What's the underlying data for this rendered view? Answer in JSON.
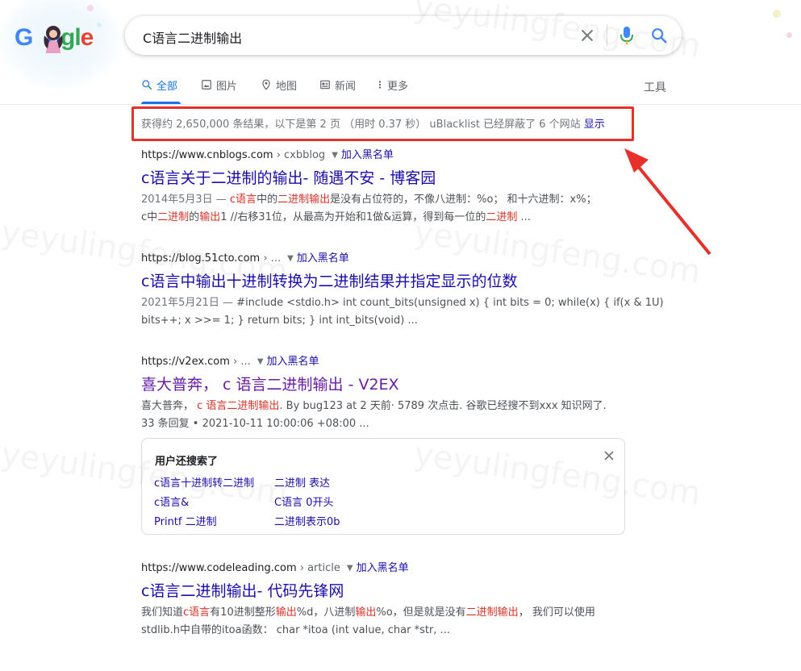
{
  "header": {
    "logo_text": "Google",
    "search_query": "C语言二进制输出"
  },
  "tabs": [
    {
      "label": "全部",
      "icon": "search-icon",
      "active": true
    },
    {
      "label": "图片",
      "icon": "image-icon"
    },
    {
      "label": "地图",
      "icon": "map-pin-icon"
    },
    {
      "label": "新闻",
      "icon": "news-icon"
    },
    {
      "label": "更多",
      "icon": "more-vert-icon"
    }
  ],
  "tools_label": "工具",
  "stats": {
    "text": "获得约 2,650,000 条结果，以下是第 2 页 （用时 0.37 秒） uBlacklist 已经屏蔽了 6 个网站",
    "show_link": "显示"
  },
  "results": [
    {
      "url": "https://www.cnblogs.com",
      "path": " › cxbblog",
      "block_label": "加入黑名单",
      "title": "c语言关于二进制的输出- 随遇不安 - 博客园",
      "snippet_line1": [
        {
          "t": "2014年5月3日 — ",
          "c": "date"
        },
        {
          "t": "c语言",
          "c": "hl"
        },
        {
          "t": "中的",
          "c": ""
        },
        {
          "t": "二进制输出",
          "c": "hl"
        },
        {
          "t": "是没有占位符的，不像八进制：%o； 和十六进制：x%；",
          "c": ""
        }
      ],
      "snippet_line2": [
        {
          "t": "c中",
          "c": ""
        },
        {
          "t": "二进制",
          "c": "hl"
        },
        {
          "t": "的",
          "c": ""
        },
        {
          "t": "输出",
          "c": "hl"
        },
        {
          "t": "1 //右移31位，从最高为开始和1做&运算，得到每一位的",
          "c": ""
        },
        {
          "t": "二进制",
          "c": "hl"
        },
        {
          "t": " ...",
          "c": ""
        }
      ]
    },
    {
      "url": "https://blog.51cto.com",
      "path": " › ...",
      "block_label": "加入黑名单",
      "title": "c语言中输出十进制转换为二进制结果并指定显示的位数",
      "snippet_line1": [
        {
          "t": "2021年5月21日 — ",
          "c": "date"
        },
        {
          "t": "#include <stdio.h> int count_bits(unsigned x) { int bits = 0; while(x) { if(x & 1U)",
          "c": ""
        }
      ],
      "snippet_line2": [
        {
          "t": "bits++; x >>= 1; } return bits; } int int_bits(void) ...",
          "c": ""
        }
      ]
    },
    {
      "url": "https://v2ex.com",
      "path": " › ...",
      "block_label": "加入黑名单",
      "title": "喜大普奔， c 语言二进制输出 - V2EX",
      "visited": true,
      "snippet_line1": [
        {
          "t": "喜大普奔， ",
          "c": ""
        },
        {
          "t": "c 语言二进制输出",
          "c": "hl"
        },
        {
          "t": ". By bug123 at 2 天前· 5789 次点击. 谷歌已经搜不到xxx 知识网了.",
          "c": ""
        }
      ],
      "snippet_line2": [
        {
          "t": "33 条回复 • 2021-10-11 10:00:06 +08:00 ...",
          "c": ""
        }
      ]
    },
    {
      "url": "https://www.codeleading.com",
      "path": " › article",
      "block_label": "加入黑名单",
      "title": "c语言二进制输出- 代码先锋网",
      "snippet_line1": [
        {
          "t": "我们知道",
          "c": ""
        },
        {
          "t": "c语言",
          "c": "hl"
        },
        {
          "t": "有10进制整形",
          "c": ""
        },
        {
          "t": "输出",
          "c": "hl"
        },
        {
          "t": "%d，八进制",
          "c": ""
        },
        {
          "t": "输出",
          "c": "hl"
        },
        {
          "t": "%o，但是就是没有",
          "c": ""
        },
        {
          "t": "二进制输出",
          "c": "hl"
        },
        {
          "t": "， 我们可以使用",
          "c": ""
        }
      ],
      "snippet_line2": [
        {
          "t": "stdlib.h中自带的itoa函数： char *itoa (int value, char *str, ...",
          "c": ""
        }
      ]
    }
  ],
  "people_also_search": {
    "title": "用户还搜索了",
    "items": [
      "c语言十进制转二进制",
      "二进制 表达",
      "c语言&",
      "C语言 0开头",
      "Printf 二进制",
      "二进制表示0b"
    ]
  },
  "watermark": "yeyulingfeng.com",
  "colors": {
    "link": "#1a0dab",
    "visited": "#681da8",
    "highlight": "#d93025",
    "accent": "#1a73e8",
    "annotation": "#e8302a"
  }
}
